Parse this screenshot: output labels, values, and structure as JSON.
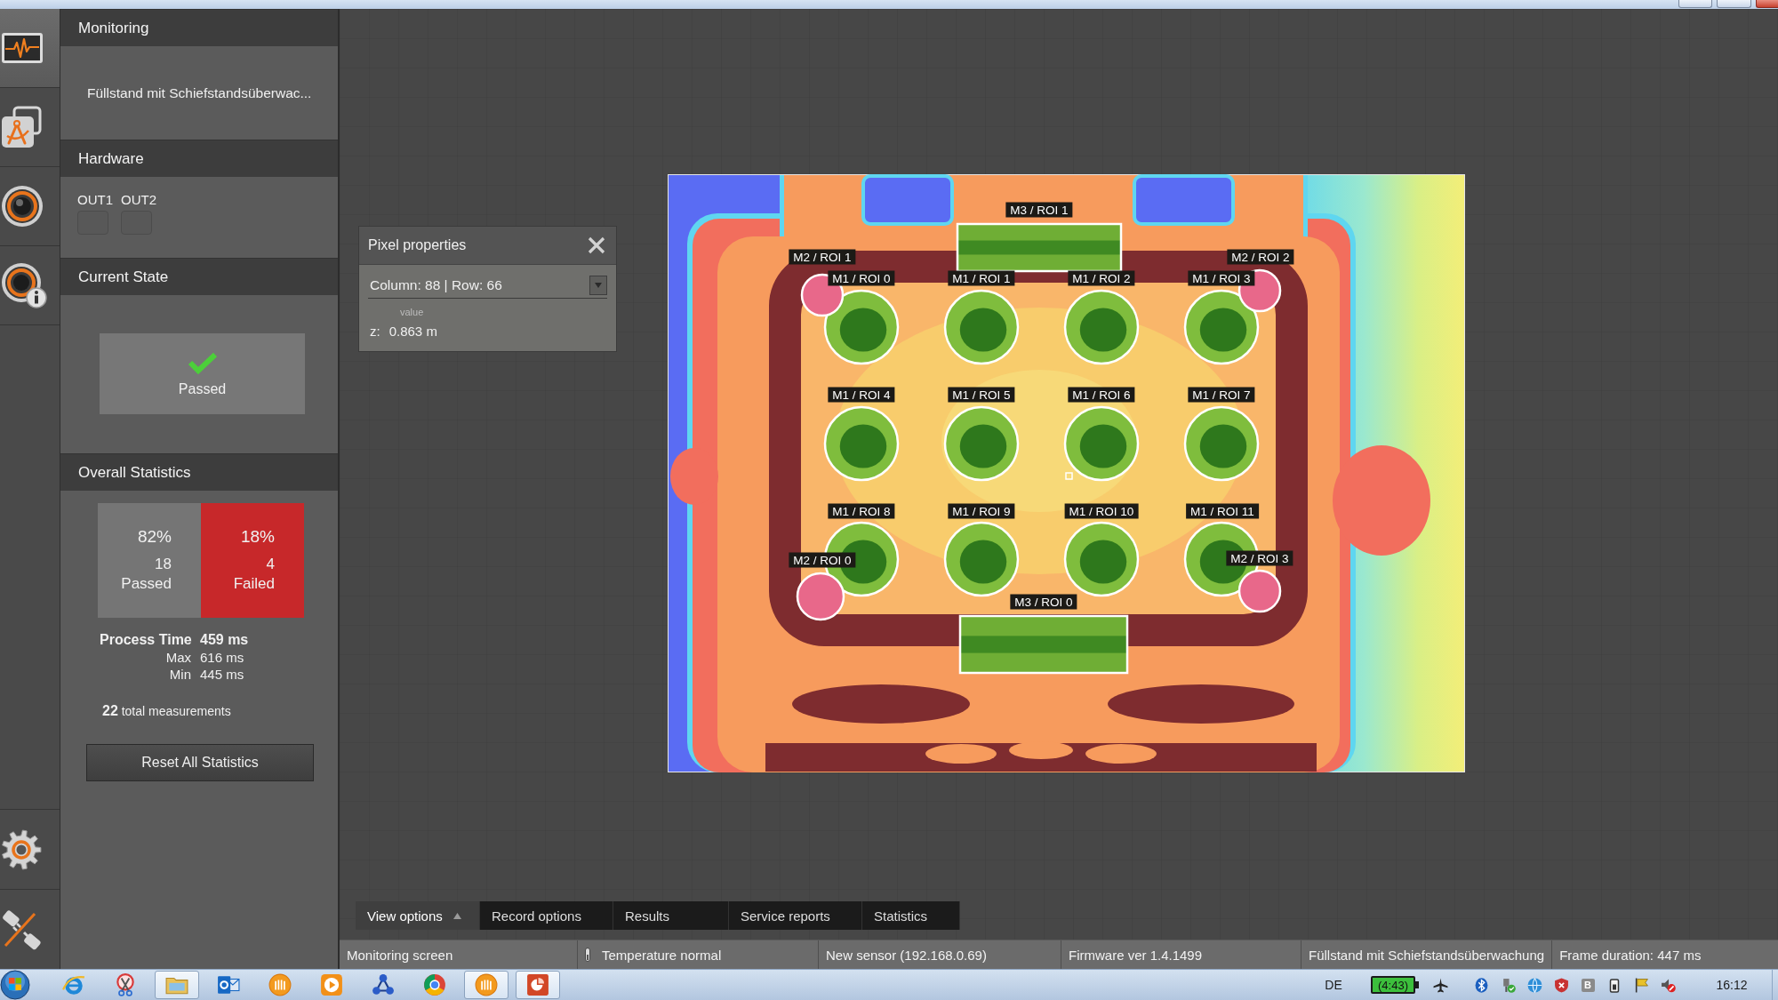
{
  "nav_top": [
    {
      "kind": "monitor",
      "selected": true
    },
    {
      "kind": "compass",
      "selected": false
    },
    {
      "kind": "speaker",
      "selected": false
    },
    {
      "kind": "speaker_info",
      "selected": false
    }
  ],
  "nav_bottom": [
    {
      "kind": "gear",
      "selected": false
    },
    {
      "kind": "plug",
      "selected": false
    }
  ],
  "monitoring": {
    "title": "Monitoring",
    "application": "Füllstand mit Schiefstandsüberwac..."
  },
  "hardware": {
    "title": "Hardware",
    "outputs": [
      {
        "label": "OUT1",
        "on": false
      },
      {
        "label": "OUT2",
        "on": false
      }
    ]
  },
  "current_state": {
    "title": "Current State",
    "passed": true,
    "label": "Passed"
  },
  "overall_statistics": {
    "title": "Overall Statistics",
    "passed": {
      "percent": "82%",
      "count": "18",
      "label": "Passed"
    },
    "failed": {
      "percent": "18%",
      "count": "4",
      "label": "Failed"
    },
    "process_time": [
      {
        "label": "Process Time",
        "value": "459 ms"
      },
      {
        "label": "Max",
        "value": "616 ms"
      },
      {
        "label": "Min",
        "value": "445 ms"
      }
    ],
    "total": "**22** total measurements",
    "reset_button": "Reset All Statistics"
  },
  "pixel_properties": {
    "title": "Pixel properties",
    "selection": "Column: 88 | Row: 66",
    "value_caption": "value",
    "axis": "z:",
    "value": "0.863 m"
  },
  "depth_image": {
    "rois": [
      {
        "label": "M3 / ROI 1",
        "kind": "rect",
        "color": "#6fae35"
      },
      {
        "label": "M2 / ROI 1",
        "kind": "dot",
        "color": "#e8688a"
      },
      {
        "label": "M2 / ROI 2",
        "kind": "dot",
        "color": "#e8688a"
      },
      {
        "label": "M1 / ROI 0",
        "kind": "circle",
        "color": "#7fbd3d"
      },
      {
        "label": "M1 / ROI 1",
        "kind": "circle",
        "color": "#7fbd3d"
      },
      {
        "label": "M1 / ROI 2",
        "kind": "circle",
        "color": "#7fbd3d"
      },
      {
        "label": "M1 / ROI 3",
        "kind": "circle",
        "color": "#7fbd3d"
      },
      {
        "label": "M1 / ROI 4",
        "kind": "circle",
        "color": "#7fbd3d"
      },
      {
        "label": "M1 / ROI 5",
        "kind": "circle",
        "color": "#7fbd3d"
      },
      {
        "label": "M1 / ROI 6",
        "kind": "circle",
        "color": "#7fbd3d"
      },
      {
        "label": "M1 / ROI 7",
        "kind": "circle",
        "color": "#7fbd3d"
      },
      {
        "label": "M1 / ROI 8",
        "kind": "circle",
        "color": "#7fbd3d"
      },
      {
        "label": "M1 / ROI 9",
        "kind": "circle",
        "color": "#7fbd3d"
      },
      {
        "label": "M1 / ROI 10",
        "kind": "circle",
        "color": "#7fbd3d"
      },
      {
        "label": "M1 / ROI 11",
        "kind": "circle",
        "color": "#7fbd3d"
      },
      {
        "label": "M2 / ROI 0",
        "kind": "dot",
        "color": "#e8688a"
      },
      {
        "label": "M2 / ROI 3",
        "kind": "dot",
        "color": "#e8688a"
      },
      {
        "label": "M3 / ROI 0",
        "kind": "rect",
        "color": "#6fae35"
      }
    ]
  },
  "tabs": [
    {
      "label": "View options",
      "selected": true
    },
    {
      "label": "Record options",
      "selected": false
    },
    {
      "label": "Results",
      "selected": false
    },
    {
      "label": "Service reports",
      "selected": false
    },
    {
      "label": "Statistics",
      "selected": false
    }
  ],
  "status_bar": [
    {
      "kind": "plain",
      "text": "Monitoring screen"
    },
    {
      "kind": "temperature",
      "text": "Temperature normal"
    },
    {
      "kind": "plain",
      "text": "New sensor (192.168.0.69)"
    },
    {
      "kind": "plain",
      "text": "Firmware ver 1.4.1499"
    },
    {
      "kind": "plain",
      "text": "Füllstand mit Schiefstandsüberwachung"
    },
    {
      "kind": "plain",
      "text": "Frame duration: 447 ms"
    }
  ],
  "taskbar": {
    "apps": [
      {
        "kind": "ring",
        "active": false
      },
      {
        "kind": "scissors",
        "active": false
      },
      {
        "kind": "folder",
        "active": true
      },
      {
        "kind": "mail",
        "active": false
      },
      {
        "kind": "disc",
        "active": false
      },
      {
        "kind": "play",
        "active": false
      },
      {
        "kind": "network",
        "active": false
      },
      {
        "kind": "wheel",
        "active": false
      },
      {
        "kind": "disc",
        "active": true
      },
      {
        "kind": "slides",
        "active": true
      }
    ],
    "language": "DE",
    "battery": "(4:43)",
    "tray_icons": [
      {
        "kind": "airplane"
      },
      {
        "kind": "bluetooth"
      },
      {
        "kind": "plug_check"
      },
      {
        "kind": "globe"
      },
      {
        "kind": "shield"
      },
      {
        "kind": "letter",
        "label": "B"
      },
      {
        "kind": "phone"
      },
      {
        "kind": "flag"
      },
      {
        "kind": "speaker_muted"
      }
    ],
    "clock": "16:12"
  }
}
